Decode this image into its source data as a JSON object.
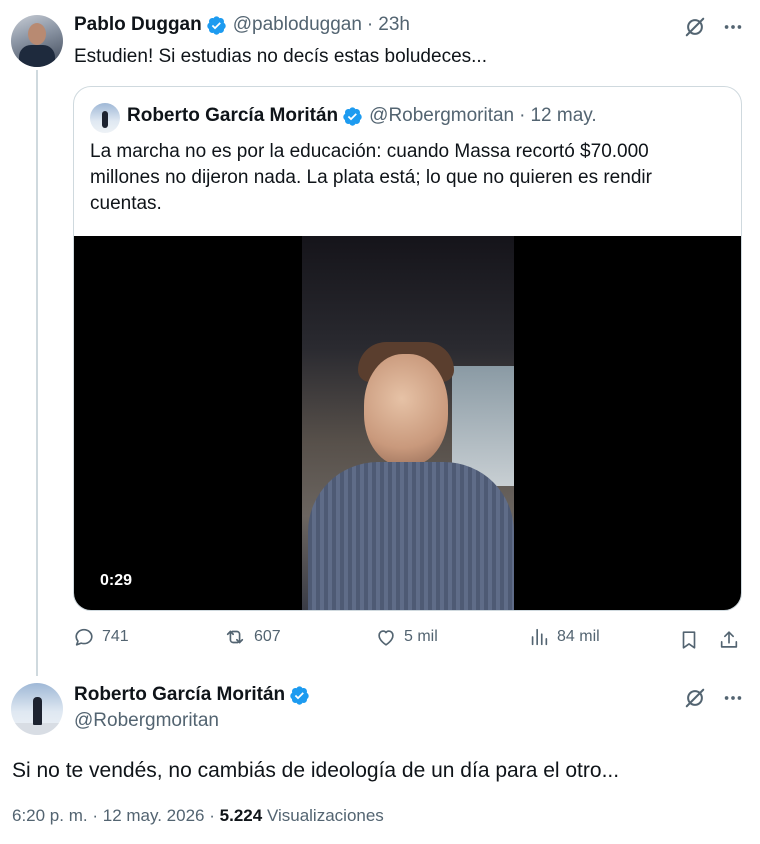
{
  "parent_tweet": {
    "author_name": "Pablo Duggan",
    "handle": "@pabloduggan",
    "separator": "·",
    "time": "23h",
    "text": "Estudien! Si estudias no decís estas boludeces...",
    "quoted": {
      "author_name": "Roberto García Moritán",
      "handle": "@Robergmoritan",
      "separator": "·",
      "date": "12 may.",
      "text": "La marcha no es por la educación: cuando Massa recortó $70.000 millones no dijeron nada. La plata está; lo que no quieren es rendir cuentas.",
      "video_duration": "0:29"
    },
    "stats": {
      "replies": "741",
      "reposts": "607",
      "likes": "5 mil",
      "views": "84 mil"
    }
  },
  "main_tweet": {
    "author_name": "Roberto García Moritán",
    "handle": "@Robergmoritan",
    "text": "Si no te vendés, no cambiás de ideología de un día para el otro...",
    "time": "6:20 p. m.",
    "separator": "·",
    "date": "12 may. 2026",
    "views_count": "5.224",
    "views_label": "Visualizaciones"
  },
  "colors": {
    "verified": "#1d9bf0",
    "text_primary": "#0f1419",
    "text_secondary": "#536471",
    "border": "#cfd9de"
  },
  "icons": [
    "grok-icon",
    "more-icon",
    "verified-badge-icon",
    "reply-icon",
    "repost-icon",
    "like-icon",
    "views-icon",
    "bookmark-icon",
    "share-icon"
  ]
}
